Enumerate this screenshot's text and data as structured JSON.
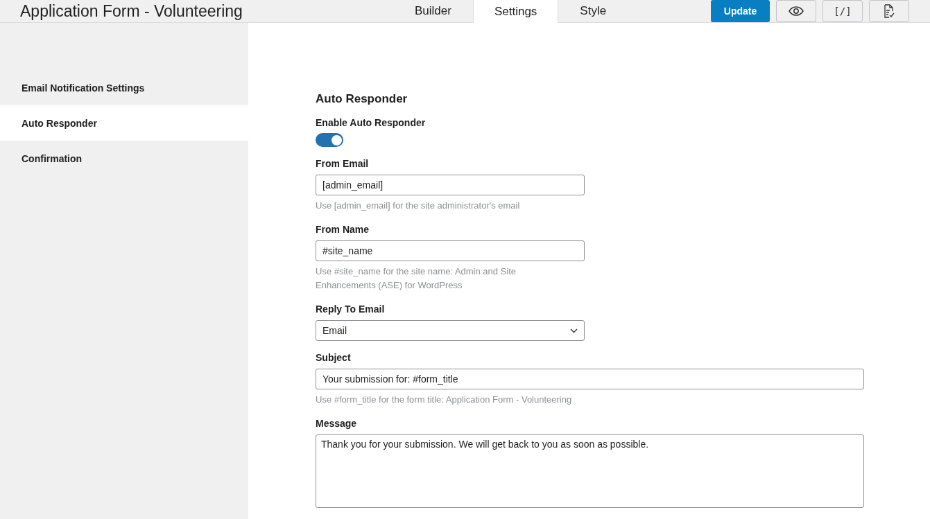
{
  "header": {
    "title": "Application Form - Volunteering",
    "tabs": [
      {
        "label": "Builder",
        "selected": false
      },
      {
        "label": "Settings",
        "selected": true
      },
      {
        "label": "Style",
        "selected": false
      }
    ],
    "update_button": "Update",
    "icon_buttons": [
      {
        "kind": "preview"
      },
      {
        "kind": "code",
        "label": "[/]"
      },
      {
        "kind": "entries"
      }
    ]
  },
  "sidebar": {
    "items": [
      {
        "label": "Email Notification Settings",
        "selected": false
      },
      {
        "label": "Auto Responder",
        "selected": true
      },
      {
        "label": "Confirmation",
        "selected": false
      }
    ]
  },
  "section": {
    "title": "Auto Responder",
    "fields": [
      {
        "kind": "toggle",
        "label": "Enable Auto Responder",
        "on": true
      },
      {
        "kind": "short-text",
        "label": "From Email",
        "value": "[admin_email]",
        "hint": "Use [admin_email] for the site administrator's email"
      },
      {
        "kind": "short-text",
        "label": "From Name",
        "value": "#site_name",
        "hint": "Use #site_name for the site name: Admin and Site Enhancements (ASE) for WordPress"
      },
      {
        "kind": "select",
        "label": "Reply To Email",
        "value": "Email"
      },
      {
        "kind": "long-text",
        "label": "Subject",
        "value": "Your submission for: #form_title",
        "hint": "Use #form_title for the form title: Application Form - Volunteering"
      },
      {
        "kind": "textarea",
        "label": "Message",
        "value": "Thank you for your submission. We will get back to you as soon as possible."
      }
    ]
  }
}
